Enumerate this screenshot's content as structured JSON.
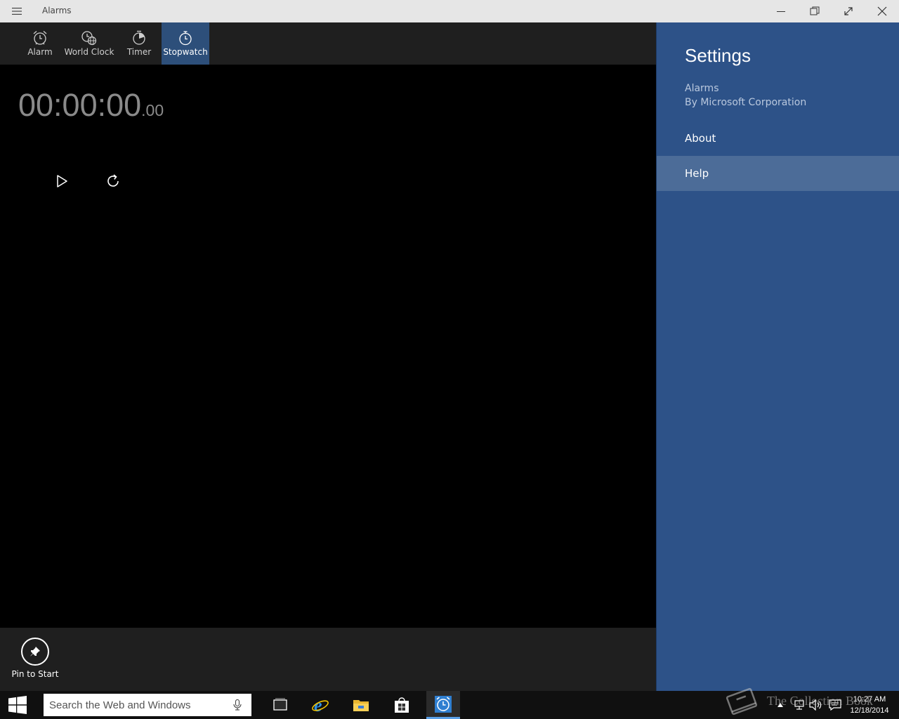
{
  "window": {
    "title": "Alarms"
  },
  "tabs": [
    {
      "label": "Alarm",
      "icon": "alarm-clock-icon",
      "active": false
    },
    {
      "label": "World Clock",
      "icon": "world-clock-icon",
      "active": false
    },
    {
      "label": "Timer",
      "icon": "timer-icon",
      "active": false
    },
    {
      "label": "Stopwatch",
      "icon": "stopwatch-icon",
      "active": true
    }
  ],
  "stopwatch": {
    "time_main": "00:00:00",
    "time_fraction": ".00"
  },
  "appbar": {
    "pin_label": "Pin to Start"
  },
  "settings": {
    "title": "Settings",
    "app_name": "Alarms",
    "publisher": "By Microsoft Corporation",
    "items": [
      {
        "label": "About"
      },
      {
        "label": "Help"
      }
    ]
  },
  "taskbar": {
    "search_placeholder": "Search the Web and Windows",
    "time": "10:27 AM",
    "date": "12/18/2014"
  },
  "watermark": {
    "text": "The Collection Book"
  },
  "colors": {
    "accent": "#2d4f7a",
    "settings_bg": "#2d5288",
    "settings_hover": "#4c6c98",
    "app_bar": "#1f1f1f",
    "titlebar": "#e6e6e6"
  }
}
